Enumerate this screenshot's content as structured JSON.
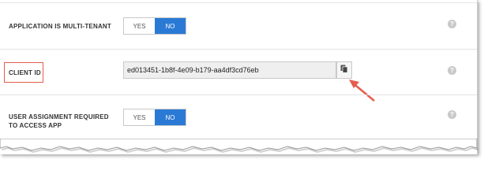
{
  "settings": {
    "multi_tenant": {
      "label": "APPLICATION IS MULTI-TENANT",
      "yes": "YES",
      "no": "NO",
      "selected": "NO"
    },
    "client_id": {
      "label": "CLIENT ID",
      "value": "ed013451-1b8f-4e09-b179-aa4df3cd76eb",
      "copy_icon": "copy-icon"
    },
    "user_assignment": {
      "label": "USER ASSIGNMENT REQUIRED TO ACCESS APP",
      "yes": "YES",
      "no": "NO",
      "selected": "NO"
    },
    "help_glyph": "?"
  },
  "annotation": {
    "highlight_color": "#e35d4d",
    "arrow_color": "#e35d4d"
  },
  "colors": {
    "toggle_active": "#2a7ad5",
    "help_icon": "#c9c9c9"
  }
}
